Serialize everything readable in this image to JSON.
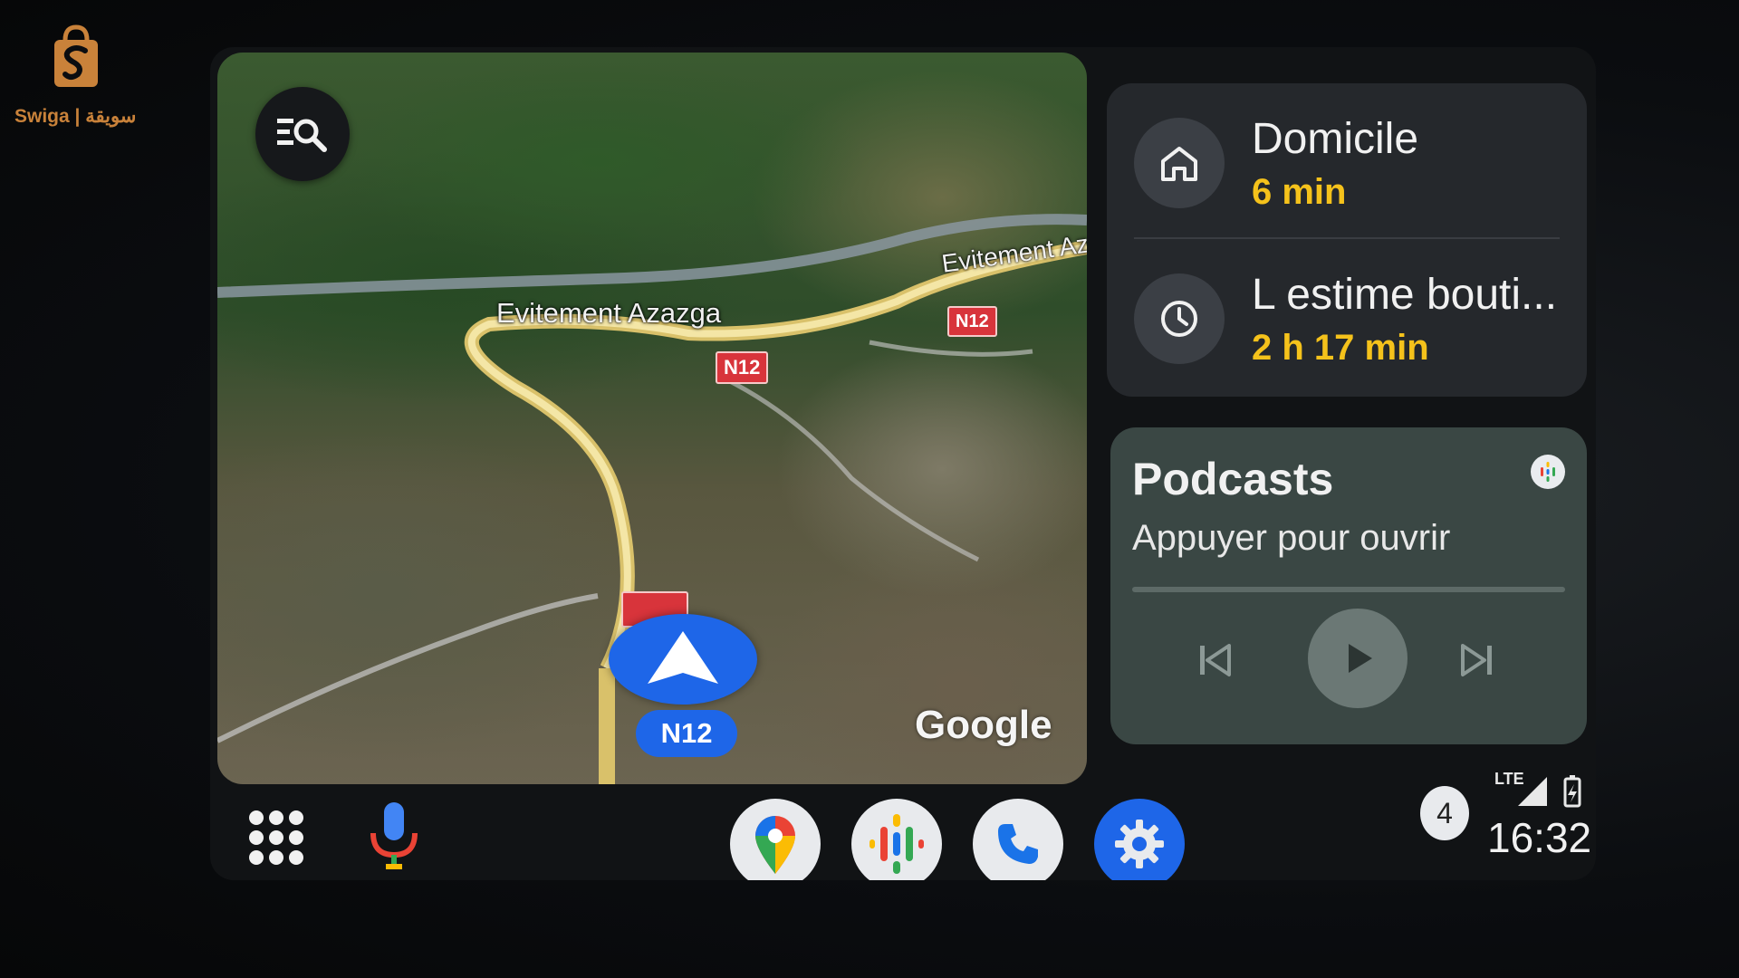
{
  "watermark": {
    "brand": "Swiga | سويقة",
    "logo_icon": "shopping-bag-s-logo-icon"
  },
  "map": {
    "search_icon": "menu-search-icon",
    "road_labels": [
      "Evitement Azazga",
      "Evitement Az"
    ],
    "shields": [
      "N12",
      "N12",
      "N12"
    ],
    "current_road": "N12",
    "provider": "Google",
    "nav_icon": "navigation-arrow-icon"
  },
  "destinations": [
    {
      "icon": "home-icon",
      "title": "Domicile",
      "eta": "6 min"
    },
    {
      "icon": "clock-icon",
      "title": "L estime bouti...",
      "eta": "2 h 17 min"
    }
  ],
  "media": {
    "title": "Podcasts",
    "subtitle": "Appuyer pour ouvrir",
    "app_icon": "google-podcasts-icon",
    "controls": [
      "skip-previous-icon",
      "play-icon",
      "skip-next-icon"
    ]
  },
  "dock": {
    "launcher_icon": "app-grid-icon",
    "mic_icon": "microphone-icon",
    "apps": [
      "google-maps-icon",
      "google-podcasts-icon",
      "phone-icon",
      "settings-icon"
    ]
  },
  "status": {
    "notification_count": "4",
    "network": "LTE",
    "time": "16:32"
  },
  "colors": {
    "accent": "#1e66e8",
    "eta": "#f5c21b",
    "card_bg": "#25282c",
    "media_bg": "#3a4744",
    "shield_red": "#d8343b"
  }
}
